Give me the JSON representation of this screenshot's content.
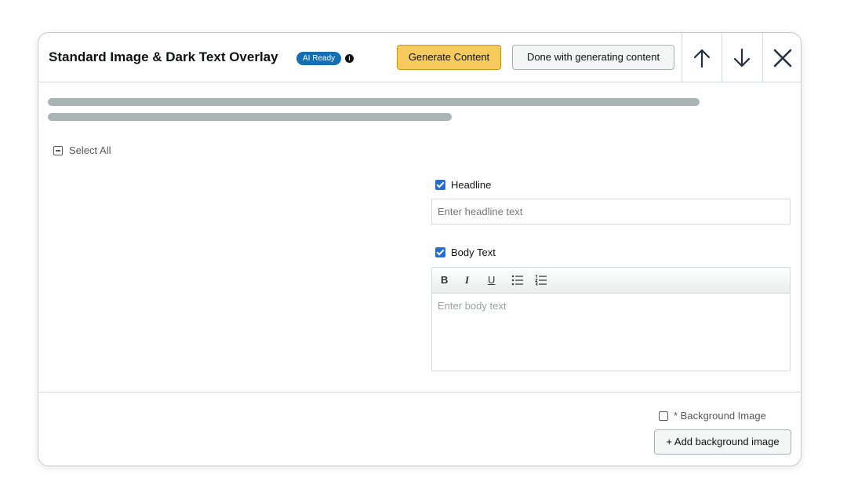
{
  "header": {
    "title": "Standard Image & Dark Text Overlay",
    "badge": "AI Ready",
    "info_icon": "info-icon",
    "generate_label": "Generate Content",
    "done_label": "Done with generating content",
    "icons": [
      "arrow-up-icon",
      "arrow-down-icon",
      "close-icon"
    ]
  },
  "select_all": {
    "label": "Select All",
    "state": "indeterminate"
  },
  "fields": {
    "headline": {
      "label": "Headline",
      "checked": true,
      "placeholder": "Enter headline text",
      "value": ""
    },
    "body": {
      "label": "Body Text",
      "checked": true,
      "placeholder": "Enter body text",
      "toolbar": {
        "bold": "B",
        "italic": "I",
        "underline": "U",
        "icons": [
          "bullet-list-icon",
          "numbered-list-icon"
        ]
      }
    }
  },
  "footer": {
    "background_label": "* Background Image",
    "background_checked": false,
    "add_background_label": "+ Add background image"
  },
  "colors": {
    "generate_button": "#f7ca5d",
    "badge": "#146eb4",
    "checkbox": "#1e6fd9",
    "skeleton": "#a9b4b4"
  }
}
